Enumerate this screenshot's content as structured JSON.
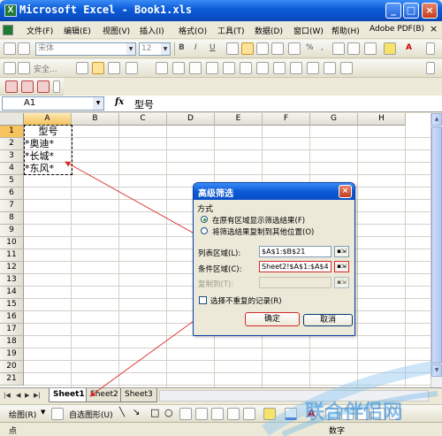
{
  "app": {
    "icon_letter": "X",
    "title": "Microsoft Excel - Book1.xls",
    "window_buttons": {
      "minimize": "_",
      "maximize": "□",
      "close": "×"
    }
  },
  "menu": {
    "items": [
      "文件(F)",
      "编辑(E)",
      "视图(V)",
      "插入(I)",
      "格式(O)",
      "工具(T)",
      "数据(D)",
      "窗口(W)",
      "帮助(H)",
      "Adobe PDF(B)"
    ],
    "doc_close": "×"
  },
  "toolbar_format": {
    "font_name": "宋体",
    "font_size": "12",
    "bold": "B",
    "italic": "I",
    "underline": "U",
    "percent": "%",
    "thousands": ",",
    "font_color_letter": "A"
  },
  "toolbar_security": {
    "security_label": "安全..."
  },
  "formula_bar": {
    "name_box": "A1",
    "fx": "fx",
    "value": "型号"
  },
  "sheet": {
    "columns": [
      "A",
      "B",
      "C",
      "D",
      "E",
      "F",
      "G",
      "H"
    ],
    "rows": [
      "1",
      "2",
      "3",
      "4",
      "5",
      "6",
      "7",
      "8",
      "9",
      "10",
      "11",
      "12",
      "13",
      "14",
      "15",
      "16",
      "17",
      "18",
      "19",
      "20",
      "21"
    ],
    "cells_a": [
      "型号",
      "*奥迪*",
      "*长城*",
      "*东风*"
    ]
  },
  "tabs": {
    "sheets": [
      "Sheet1",
      "Sheet2",
      "Sheet3"
    ],
    "active": "Sheet1"
  },
  "draw_toolbar": {
    "draw_label": "绘图(R)",
    "autoshape_label": "自选图形(U)"
  },
  "status": {
    "text": "点",
    "mode": "数字"
  },
  "watermark": {
    "text": "联合伴侣网"
  },
  "dialog": {
    "title": "高级筛选",
    "close": "×",
    "method_label": "方式",
    "options": [
      "在原有区域显示筛选结果(F)",
      "将筛选结果复制到其他位置(O)"
    ],
    "list_range_label": "列表区域(L):",
    "list_range_value": "$A$1:$B$21",
    "criteria_range_label": "条件区域(C):",
    "criteria_range_value": "Sheet2!$A$1:$A$4",
    "copy_to_label": "复制到(T):",
    "copy_to_value": "",
    "unique_label": "选择不重复的记录(R)",
    "ok_label": "确定",
    "cancel_label": "取消"
  },
  "colors": {
    "titlebar": "#0b5ad6",
    "annotation": "#d42a2a",
    "marquee": "#000000"
  }
}
